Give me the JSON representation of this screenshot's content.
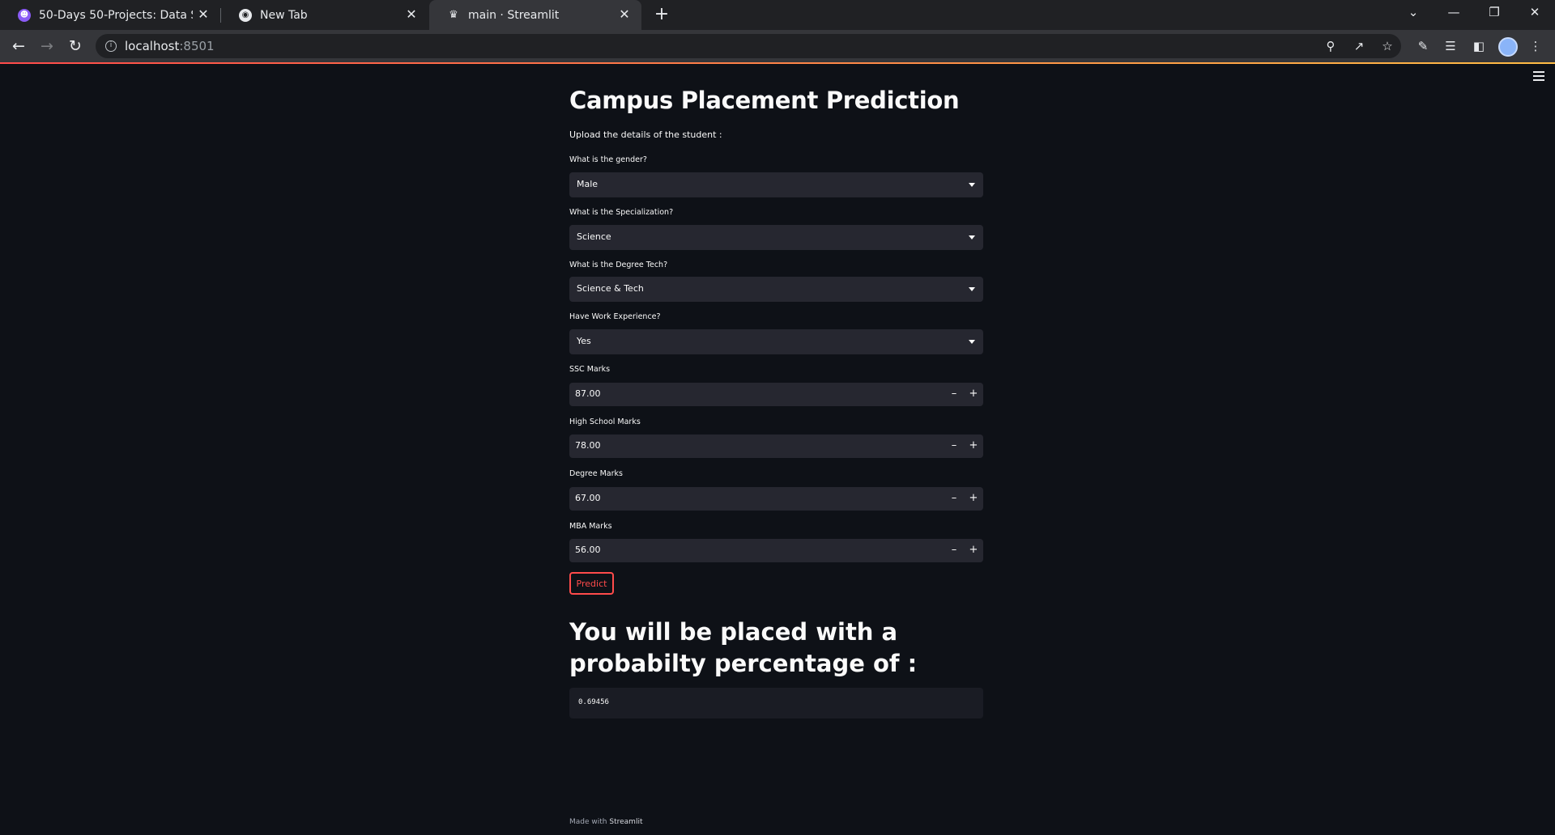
{
  "browser": {
    "tabs": [
      {
        "title": "50-Days 50-Projects: Data Scienc",
        "icon": "app-logo-icon",
        "active": false
      },
      {
        "title": "New Tab",
        "icon": "chrome-icon",
        "active": false
      },
      {
        "title": "main · Streamlit",
        "icon": "streamlit-icon",
        "active": true
      }
    ],
    "address": {
      "host": "localhost",
      "port": ":8501"
    }
  },
  "app": {
    "title": "Campus Placement Prediction",
    "subtitle": "Upload the details of the student :",
    "fields": {
      "gender": {
        "label": "What is the gender?",
        "value": "Male"
      },
      "specialization": {
        "label": "What is the Specialization?",
        "value": "Science"
      },
      "degree_tech": {
        "label": "What is the Degree Tech?",
        "value": "Science & Tech"
      },
      "work_experience": {
        "label": "Have Work Experience?",
        "value": "Yes"
      },
      "ssc": {
        "label": "SSC Marks",
        "value": "87.00"
      },
      "high_school": {
        "label": "High School Marks",
        "value": "78.00"
      },
      "degree": {
        "label": "Degree Marks",
        "value": "67.00"
      },
      "mba": {
        "label": "MBA Marks",
        "value": "56.00"
      }
    },
    "predict_label": "Predict",
    "result_heading": "You will be placed with a probabilty percentage of :",
    "result_value": "0.69456",
    "footer": {
      "prefix": "Made with",
      "brand": "Streamlit"
    }
  },
  "colors": {
    "background": "#0e1117",
    "input_bg": "#262730",
    "accent": "#ff4b4b"
  }
}
